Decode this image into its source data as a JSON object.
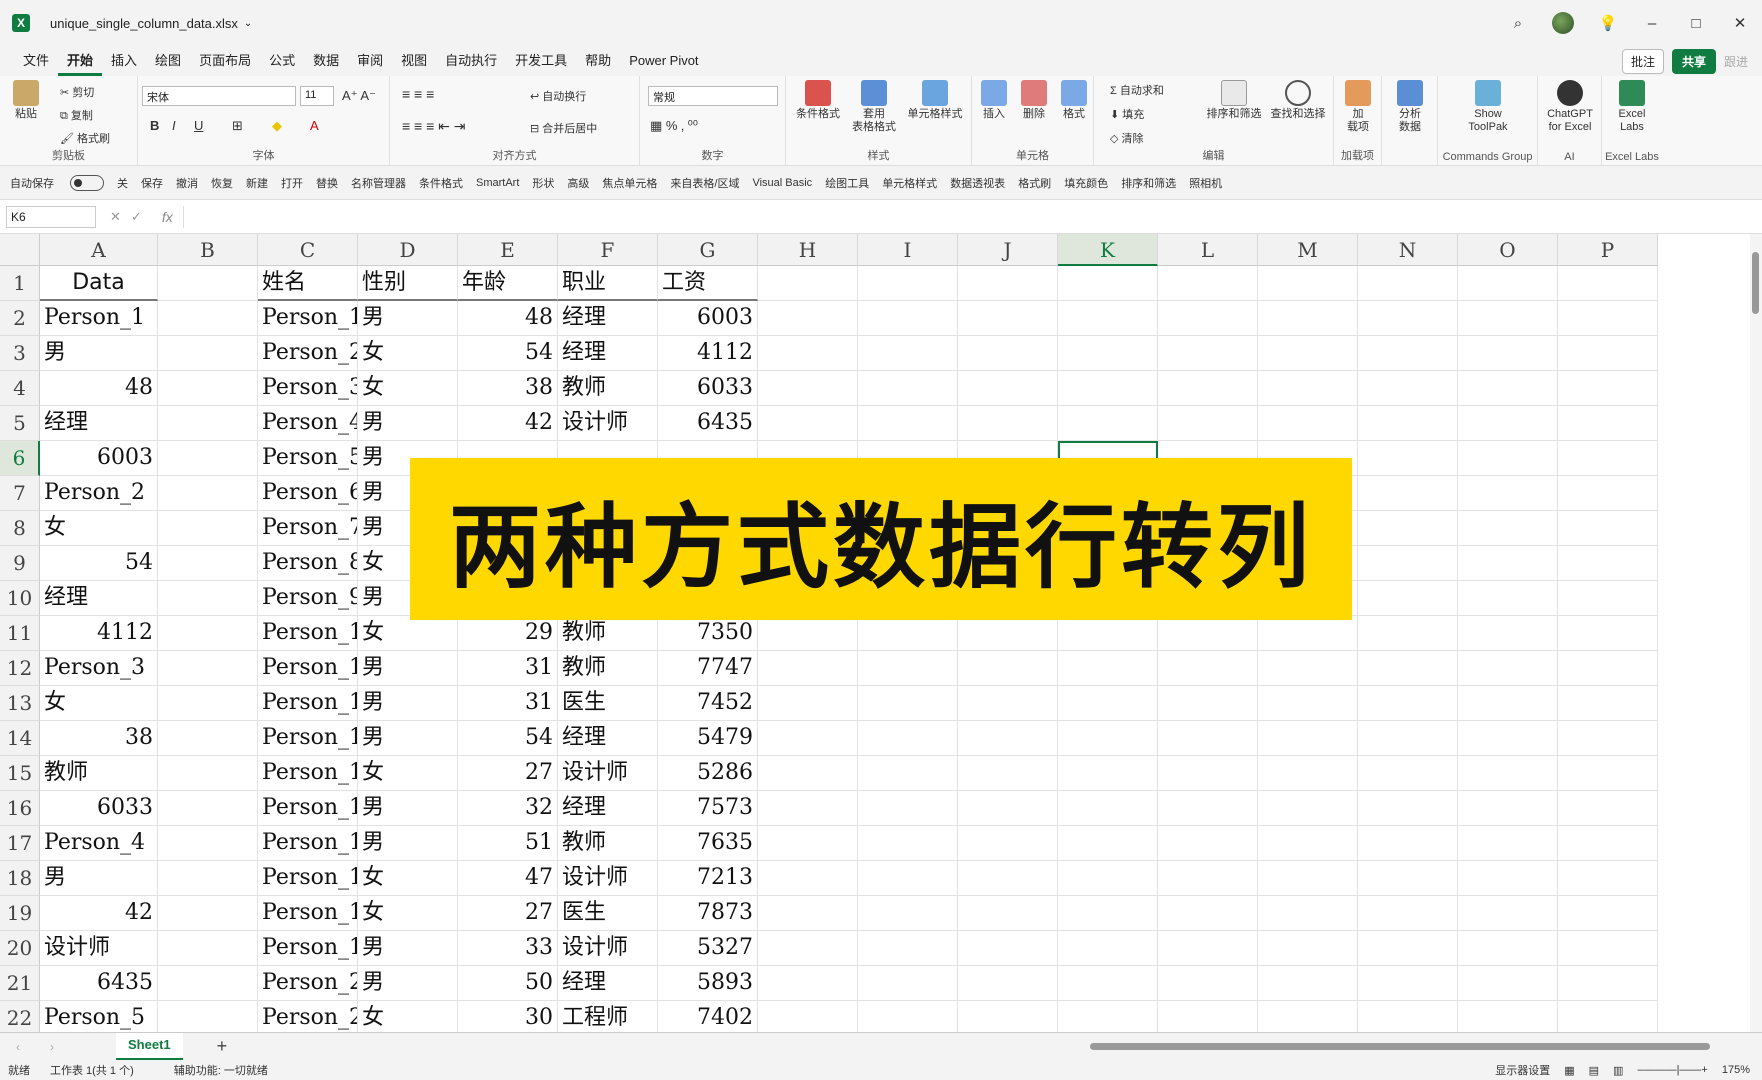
{
  "window": {
    "filename": "unique_single_column_data.xlsx",
    "minimize": "–",
    "maximize": "□",
    "close": "✕"
  },
  "menu": {
    "tabs": [
      "文件",
      "开始",
      "插入",
      "绘图",
      "页面布局",
      "公式",
      "数据",
      "审阅",
      "视图",
      "自动执行",
      "开发工具",
      "帮助",
      "Power Pivot"
    ],
    "active": "开始",
    "comment": "批注",
    "share": "共享",
    "forward": "跟进"
  },
  "ribbon": {
    "clipboard": {
      "paste": "粘贴",
      "cut": "剪切",
      "copy": "复制",
      "format_painter": "格式刷",
      "label": "剪贴板"
    },
    "font": {
      "name": "宋体",
      "size": "11",
      "label": "字体"
    },
    "align": {
      "wrap": "自动换行",
      "merge": "合并后居中",
      "label": "对齐方式"
    },
    "number": {
      "format": "常规",
      "label": "数字"
    },
    "styles": {
      "cond": "条件格式",
      "table": "套用\n表格格式",
      "cell": "单元格样式",
      "label": "样式"
    },
    "cells": {
      "insert": "插入",
      "delete": "删除",
      "format": "格式",
      "label": "单元格"
    },
    "edit": {
      "autosum": "自动求和",
      "fill": "填充",
      "clear": "清除",
      "sort": "排序和筛选",
      "find": "查找和选择",
      "label": "编辑"
    },
    "addins": {
      "addin": "加\n载项",
      "label": "加载项"
    },
    "analyze": {
      "label": "分析\n数据"
    },
    "toolpak": {
      "btn": "Show\nToolPak",
      "label": "Commands Group"
    },
    "gpt": {
      "btn": "ChatGPT\nfor Excel",
      "label": "AI"
    },
    "labs": {
      "btn": "Excel\nLabs",
      "label": "Excel Labs"
    }
  },
  "qat": [
    "自动保存",
    "关",
    "保存",
    "撤消",
    "恢复",
    "新建",
    "打开",
    "替换",
    "名称管理器",
    "条件格式",
    "SmartArt",
    "形状",
    "高级",
    "焦点单元格",
    "来自表格/区域",
    "Visual Basic",
    "绘图工具",
    "单元格样式",
    "数据透视表",
    "格式刷",
    "填充颜色",
    "排序和筛选",
    "照相机"
  ],
  "formula": {
    "namebox": "K6",
    "fx": "fx"
  },
  "columns": [
    "A",
    "B",
    "C",
    "D",
    "E",
    "F",
    "G",
    "H",
    "I",
    "J",
    "K",
    "L",
    "M",
    "N",
    "O",
    "P"
  ],
  "selected_col": "K",
  "selected_row": "6",
  "rows": [
    "1",
    "2",
    "3",
    "4",
    "5",
    "6",
    "7",
    "8",
    "9",
    "10",
    "11",
    "12",
    "13",
    "14",
    "15",
    "16",
    "17",
    "18",
    "19",
    "20",
    "21",
    "22"
  ],
  "colA": [
    "Data",
    "Person_1",
    "男",
    "48",
    "经理",
    "6003",
    "Person_2",
    "女",
    "54",
    "经理",
    "4112",
    "Person_3",
    "女",
    "38",
    "教师",
    "6033",
    "Person_4",
    "男",
    "42",
    "设计师",
    "6435",
    "Person_5"
  ],
  "table_header": [
    "姓名",
    "性别",
    "年龄",
    "职业",
    "工资"
  ],
  "table": [
    [
      "Person_1",
      "男",
      "48",
      "经理",
      "6003"
    ],
    [
      "Person_2",
      "女",
      "54",
      "经理",
      "4112"
    ],
    [
      "Person_3",
      "女",
      "38",
      "教师",
      "6033"
    ],
    [
      "Person_4",
      "男",
      "42",
      "设计师",
      "6435"
    ],
    [
      "Person_5",
      "男",
      "",
      "",
      ""
    ],
    [
      "Person_6",
      "男",
      "",
      "",
      ""
    ],
    [
      "Person_7",
      "男",
      "",
      "",
      ""
    ],
    [
      "Person_8",
      "女",
      "",
      "",
      ""
    ],
    [
      "Person_9",
      "男",
      "",
      "",
      ""
    ],
    [
      "Person_1",
      "女",
      "29",
      "教师",
      "7350"
    ],
    [
      "Person_1",
      "男",
      "31",
      "教师",
      "7747"
    ],
    [
      "Person_1",
      "男",
      "31",
      "医生",
      "7452"
    ],
    [
      "Person_1",
      "男",
      "54",
      "经理",
      "5479"
    ],
    [
      "Person_1",
      "女",
      "27",
      "设计师",
      "5286"
    ],
    [
      "Person_1",
      "男",
      "32",
      "经理",
      "7573"
    ],
    [
      "Person_1",
      "男",
      "51",
      "教师",
      "7635"
    ],
    [
      "Person_1",
      "女",
      "47",
      "设计师",
      "7213"
    ],
    [
      "Person_1",
      "女",
      "27",
      "医生",
      "7873"
    ],
    [
      "Person_1",
      "男",
      "33",
      "设计师",
      "5327"
    ],
    [
      "Person_2",
      "男",
      "50",
      "经理",
      "5893"
    ],
    [
      "Person_2",
      "女",
      "30",
      "工程师",
      "7402"
    ]
  ],
  "banner": "两种方式数据行转列",
  "sheet": {
    "tab": "Sheet1",
    "add": "+"
  },
  "status": {
    "ready": "就绪",
    "sheets": "工作表 1(共 1 个)",
    "accessibility": "辅助功能: 一切就绪",
    "display": "显示器设置",
    "zoom": "175%"
  }
}
